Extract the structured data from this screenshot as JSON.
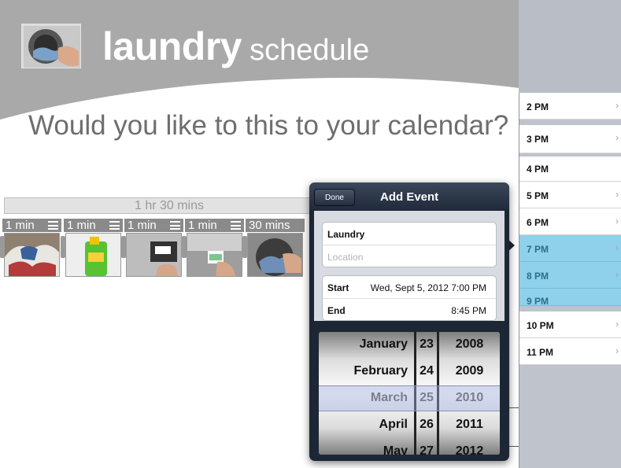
{
  "header": {
    "title_bold": "laundry",
    "title_light": "schedule",
    "logo_icon": "washing-machine-photo-icon"
  },
  "prompt": "Would you like to this to your calendar?",
  "timeline": {
    "total_label": "1 hr 30 mins",
    "steps": [
      {
        "label": "1 min",
        "icon": "pile-of-clothes-photo"
      },
      {
        "label": "1 min",
        "icon": "detergent-bottle-photo"
      },
      {
        "label": "1 min",
        "icon": "coin-slot-photo"
      },
      {
        "label": "1 min",
        "icon": "card-reader-photo"
      },
      {
        "label": "30 mins",
        "icon": "washer-drum-photo"
      }
    ]
  },
  "calendar_sidebar": {
    "rows": [
      {
        "label": "2 PM",
        "selected": false
      },
      {
        "label": "3 PM",
        "selected": false
      },
      {
        "label": "4 PM",
        "selected": false
      },
      {
        "label": "5 PM",
        "selected": false
      },
      {
        "label": "6 PM",
        "selected": false
      },
      {
        "label": "7 PM",
        "selected": true
      },
      {
        "label": "8 PM",
        "selected": true
      },
      {
        "label": "9 PM",
        "selected": true
      },
      {
        "label": "10 PM",
        "selected": false
      },
      {
        "label": "11 PM",
        "selected": false
      }
    ],
    "chevron": "›"
  },
  "add_event": {
    "done_label": "Done",
    "title": "Add Event",
    "event_title": "Laundry",
    "location_placeholder": "Location",
    "start_label": "Start",
    "start_value": "Wed, Sept 5, 2012 7:00 PM",
    "end_label": "End",
    "end_value": "8:45 PM"
  },
  "date_picker": {
    "months": [
      "January",
      "February",
      "March",
      "April",
      "May"
    ],
    "days": [
      "23",
      "24",
      "25",
      "26",
      "27"
    ],
    "years": [
      "2008",
      "2009",
      "2010",
      "2011",
      "2012"
    ],
    "selected": {
      "month": "March",
      "day": "25",
      "year": "2010"
    }
  },
  "colors": {
    "header_gray": "#a9a9a9",
    "selection_blue": "#8fd0ea",
    "popover_dark": "#1d2634"
  }
}
